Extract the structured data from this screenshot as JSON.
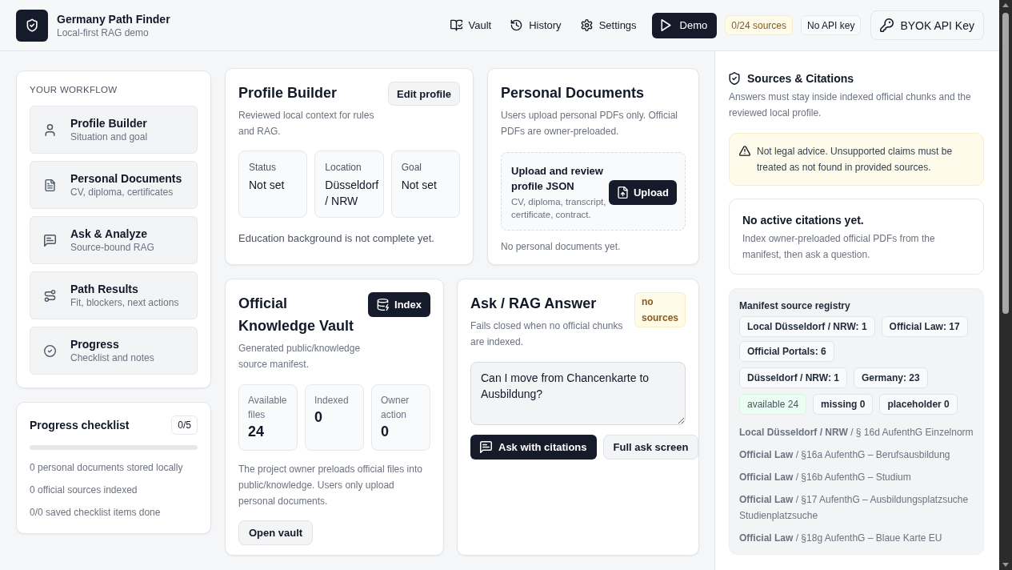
{
  "header": {
    "title": "Germany Path Finder",
    "subtitle": "Local-first RAG demo",
    "nav": [
      {
        "label": "Vault",
        "selected": false
      },
      {
        "label": "History",
        "selected": false
      },
      {
        "label": "Settings",
        "selected": false
      },
      {
        "label": "Demo",
        "selected": true
      }
    ],
    "badges": [
      {
        "label": "0/24 sources",
        "kind": "warning"
      },
      {
        "label": "No API key",
        "kind": "neutral"
      }
    ],
    "api_key_button": "BYOK API Key"
  },
  "workflow": {
    "heading": "YOUR WORKFLOW",
    "steps": [
      {
        "title": "Profile Builder",
        "subtitle": "Situation and goal"
      },
      {
        "title": "Personal Documents",
        "subtitle": "CV, diploma, certificates"
      },
      {
        "title": "Ask & Analyze",
        "subtitle": "Source-bound RAG"
      },
      {
        "title": "Path Results",
        "subtitle": "Fit, blockers, next actions"
      },
      {
        "title": "Progress",
        "subtitle": "Checklist and notes"
      }
    ]
  },
  "progress_checklist": {
    "title": "Progress checklist",
    "count": "0/5",
    "level": 0,
    "items": [
      "0 personal documents stored locally",
      "0 official sources indexed",
      "0/0 saved checklist items done"
    ]
  },
  "profile_builder": {
    "title": "Profile Builder",
    "description": "Reviewed local context for rules and RAG.",
    "edit_button": "Edit profile",
    "fields": [
      {
        "label": "Status",
        "value": "Not set"
      },
      {
        "label": "Location",
        "value": "Düsseldorf / NRW"
      },
      {
        "label": "Goal",
        "value": "Not set"
      }
    ],
    "note": "Education background is not complete yet."
  },
  "personal_documents": {
    "title": "Personal Documents",
    "description": "Users upload personal PDFs only. Official PDFs are owner-preloaded.",
    "upload": {
      "title": "Upload and review profile JSON",
      "hint": "CV, diploma, transcript, certificate, contract.",
      "button": "Upload"
    },
    "empty_note": "No personal documents yet."
  },
  "knowledge_vault": {
    "title": "Official Knowledge Vault",
    "description": "Generated public/knowledge source manifest.",
    "index_button": "Index",
    "stats": [
      {
        "label": "Available files",
        "value": "24"
      },
      {
        "label": "Indexed",
        "value": "0"
      },
      {
        "label": "Owner action",
        "value": "0"
      }
    ],
    "note": "The project owner preloads official files into public/knowledge. Users only upload personal documents.",
    "open_button": "Open vault"
  },
  "ask": {
    "title": "Ask / RAG Answer",
    "badge": "no sources",
    "description": "Fails closed when no official chunks are indexed.",
    "question": "Can I move from Chancenkarte to Ausbildung?",
    "buttons": [
      {
        "label": "Ask with citations",
        "kind": "primary"
      },
      {
        "label": "Full ask screen",
        "kind": "secondary"
      }
    ]
  },
  "sources_panel": {
    "title": "Sources & Citations",
    "description": "Answers must stay inside indexed official chunks and the reviewed local profile.",
    "warning": "Not legal advice. Unsupported claims must be treated as not found in provided sources.",
    "citations": {
      "title": "No active citations yet.",
      "description": "Index owner-preloaded official PDFs from the manifest, then ask a question."
    },
    "registry": {
      "title": "Manifest source registry",
      "category_counts": [
        "Local Düsseldorf / NRW: 1",
        "Official Law: 17",
        "Official Portals: 6"
      ],
      "region_counts": [
        "Düsseldorf / NRW: 1",
        "Germany: 23"
      ],
      "status_counts": [
        {
          "label": "available 24",
          "highlighted": true
        },
        {
          "label": "missing 0",
          "highlighted": false
        },
        {
          "label": "placeholder 0",
          "highlighted": false
        }
      ],
      "sources": [
        "**Local Düsseldorf / NRW** / § 16d AufenthG Einzelnorm",
        "**Official Law** / §16a AufenthG – Berufsausbildung",
        "**Official Law** / §16b AufenthG – Studium",
        "**Official Law** / §17 AufenthG – Ausbildungsplatzsuche Studienplatzsuche",
        "**Official Law** / §18g AufenthG – Blaue Karte EU"
      ]
    }
  }
}
